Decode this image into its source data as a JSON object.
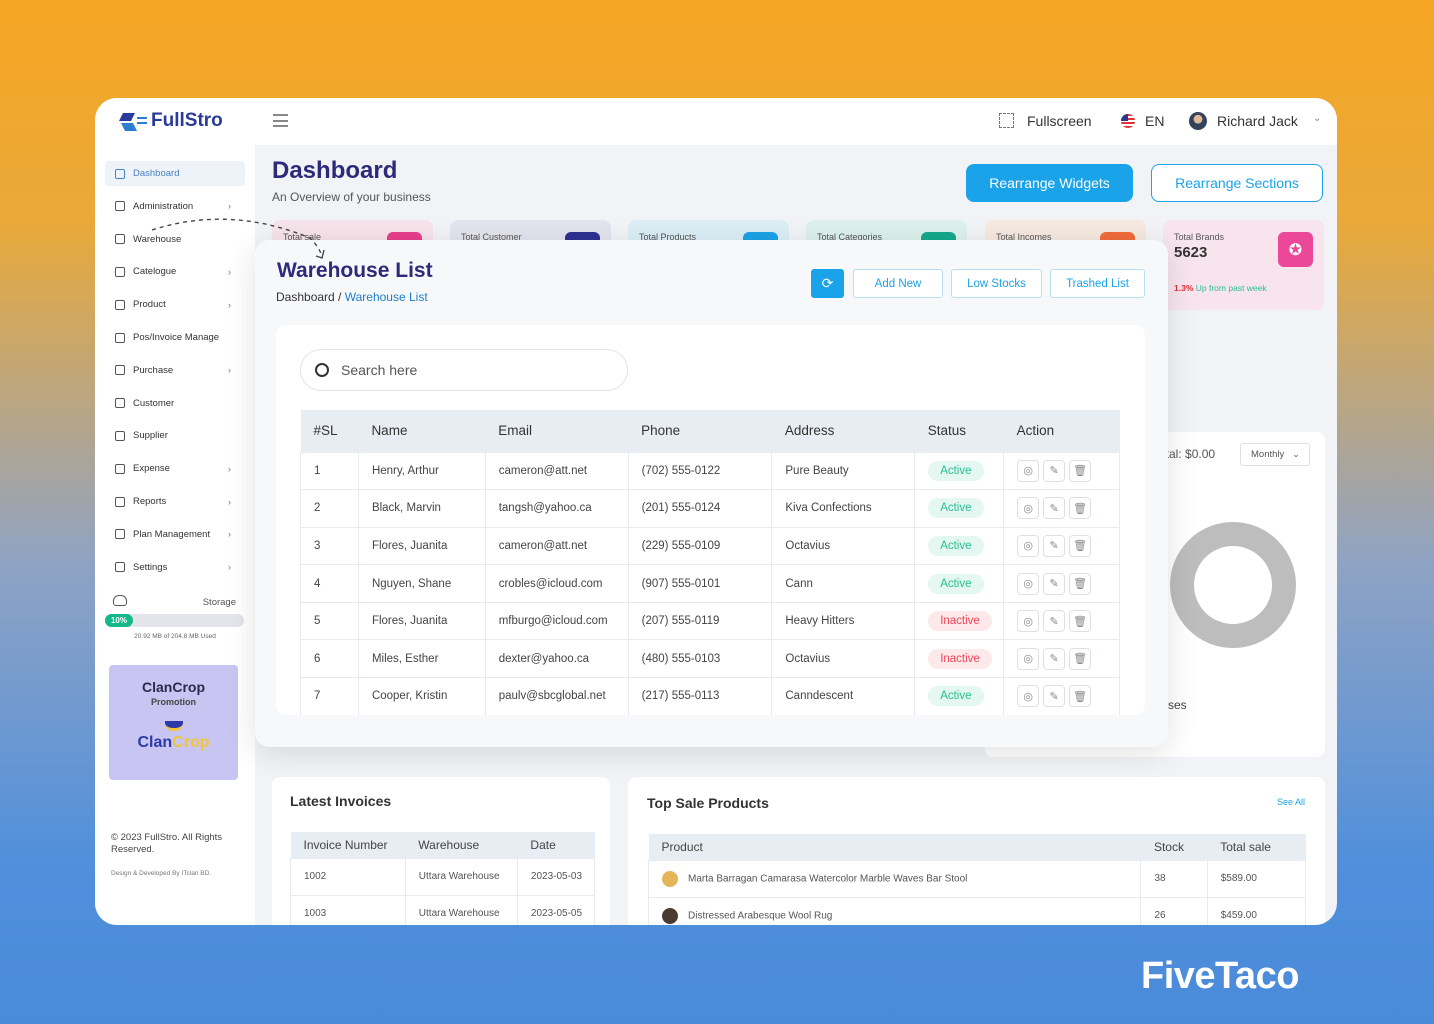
{
  "app": {
    "logo": "FullStro"
  },
  "sidebar": {
    "items": [
      {
        "label": "Dashboard",
        "icon": "home-icon",
        "chevron": false,
        "active": true
      },
      {
        "label": "Administration",
        "icon": "user-icon",
        "chevron": true
      },
      {
        "label": "Warehouse",
        "icon": "warehouse-icon",
        "chevron": false
      },
      {
        "label": "Catelogue",
        "icon": "book-icon",
        "chevron": true
      },
      {
        "label": "Product",
        "icon": "cart-icon",
        "chevron": true
      },
      {
        "label": "Pos/Invoice Manage",
        "icon": "calendar-icon",
        "chevron": false
      },
      {
        "label": "Purchase",
        "icon": "purchase-icon",
        "chevron": true
      },
      {
        "label": "Customer",
        "icon": "customer-icon",
        "chevron": false
      },
      {
        "label": "Supplier",
        "icon": "supplier-icon",
        "chevron": false
      },
      {
        "label": "Expense",
        "icon": "expense-icon",
        "chevron": true
      },
      {
        "label": "Reports",
        "icon": "reports-icon",
        "chevron": true
      },
      {
        "label": "Plan Management",
        "icon": "plan-icon",
        "chevron": true
      },
      {
        "label": "Settings",
        "icon": "gear-icon",
        "chevron": true
      }
    ],
    "chevron": "›",
    "storage": {
      "label": "Storage",
      "percent": "10%",
      "usage": "20.92 MB of 204.8 MB Used"
    },
    "promo": {
      "title": "ClanCrop",
      "subtitle": "Promotion",
      "logo_a": "Clan",
      "logo_b": "Crop"
    },
    "copyright": "© 2023 FullStro. All Rights Reserved.",
    "credit": "Design & Developed By ITclan BD."
  },
  "topbar": {
    "fullscreen": "Fullscreen",
    "language": "EN",
    "user": "Richard Jack"
  },
  "dashboard": {
    "title": "Dashboard",
    "subtitle": "An Overview of your business",
    "rearrange_widgets": "Rearrange Widgets",
    "rearrange_sections": "Rearrange Sections",
    "cards": [
      {
        "label": "Total sale",
        "color": "#e83e8c",
        "bg": "#f7e3ea"
      },
      {
        "label": "Total Customer",
        "color": "#2e3192",
        "bg": "#e4e4ee"
      },
      {
        "label": "Total Products",
        "color": "#1aa3e8",
        "bg": "#dbeef6"
      },
      {
        "label": "Total Categories",
        "color": "#14a88a",
        "bg": "#dcf1ec"
      },
      {
        "label": "Total Incomes",
        "color": "#f26b3a",
        "bg": "#f5e9e0"
      },
      {
        "label": "Total Brands",
        "value": "5623",
        "change": "1.3%",
        "change_text": "Up from past week",
        "color": "#ec4899",
        "bg": "#f8e4ec"
      }
    ],
    "chart_panel": {
      "total": "Total: $0.00",
      "period": "Monthly",
      "legend": "ses"
    },
    "invoices": {
      "title": "Latest Invoices",
      "columns": [
        "Invoice Number",
        "Warehouse",
        "Date"
      ],
      "rows": [
        [
          "1002",
          "Uttara Warehouse",
          "2023-05-03"
        ],
        [
          "1003",
          "Uttara Warehouse",
          "2023-05-05"
        ]
      ]
    },
    "top_products": {
      "title": "Top Sale Products",
      "see_all": "See All",
      "columns": [
        "Product",
        "Stock",
        "Total sale"
      ],
      "rows": [
        [
          "Marta Barragan Camarasa Watercolor Marble Waves Bar Stool",
          "38",
          "$589.00"
        ],
        [
          "Distressed Arabesque Wool Rug",
          "26",
          "$459.00"
        ]
      ]
    }
  },
  "warehouse": {
    "title": "Warehouse List",
    "breadcrumb_root": "Dashboard",
    "breadcrumb_sep": " / ",
    "breadcrumb_current": "Warehouse List",
    "add_new": "Add New",
    "low_stocks": "Low Stocks",
    "trashed_list": "Trashed List",
    "search_placeholder": "Search here",
    "columns": [
      "#SL",
      "Name",
      "Email",
      "Phone",
      "Address",
      "Status",
      "Action"
    ],
    "rows": [
      [
        "1",
        "Henry, Arthur",
        "cameron@att.net",
        "(702) 555-0122",
        "Pure Beauty",
        "Active"
      ],
      [
        "2",
        "Black, Marvin",
        "tangsh@yahoo.ca",
        "(201) 555-0124",
        "Kiva Confections",
        "Active"
      ],
      [
        "3",
        "Flores, Juanita",
        "cameron@att.net",
        "(229) 555-0109",
        "Octavius",
        "Active"
      ],
      [
        "4",
        "Nguyen, Shane",
        "crobles@icloud.com",
        "(907) 555-0101",
        "Cann",
        "Active"
      ],
      [
        "5",
        "Flores, Juanita",
        "mfburgo@icloud.com",
        "(207) 555-0119",
        "Heavy Hitters",
        "Inactive"
      ],
      [
        "6",
        "Miles, Esther",
        "dexter@yahoo.ca",
        "(480) 555-0103",
        "Octavius",
        "Inactive"
      ],
      [
        "7",
        "Cooper, Kristin",
        "paulv@sbcglobal.net",
        "(217) 555-0113",
        "Canndescent",
        "Active"
      ]
    ]
  },
  "brand": {
    "watermark": "FiveTaco"
  },
  "colors": {
    "accent": "#1aa3e8",
    "title": "#2e2a7a",
    "active": "#27c08f",
    "inactive": "#f0475a"
  }
}
